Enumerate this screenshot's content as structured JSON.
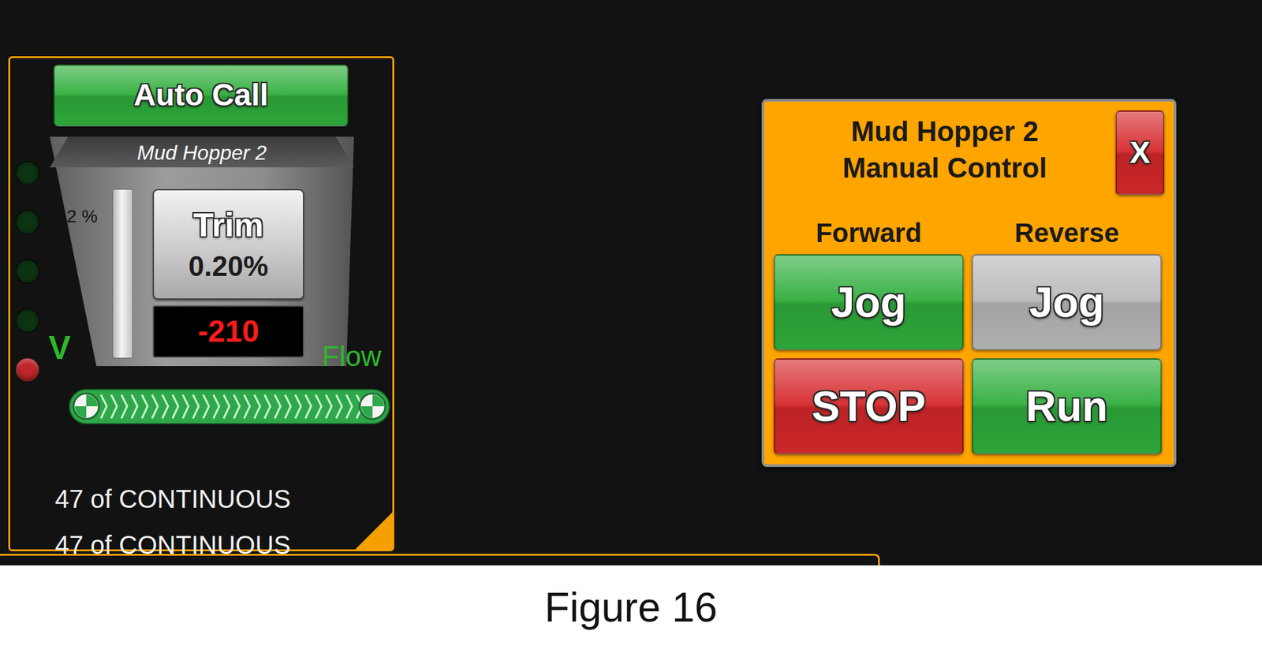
{
  "hopper_panel": {
    "auto_call": {
      "label": "Auto Call",
      "color": "#2fae3c"
    },
    "title": "Mud Hopper 2",
    "indicators": [
      {
        "on": false,
        "color": "#0d3a12"
      },
      {
        "on": false,
        "color": "#0d3a12"
      },
      {
        "on": false,
        "color": "#0d3a12"
      },
      {
        "on": false,
        "color": "#0d3a12"
      },
      {
        "on": true,
        "color": "#c0262b"
      }
    ],
    "level_reading": "-2 %",
    "level": 0,
    "trim": {
      "label": "Trim",
      "value": "0.20%"
    },
    "counter": "-210",
    "v_label": "V",
    "flow_label": "Flow",
    "conveyor_running": true,
    "status_lines": [
      "47 of CONTINUOUS",
      "47 of CONTINUOUS"
    ]
  },
  "manual_control": {
    "title_lines": [
      "Mud Hopper 2",
      "Manual Control"
    ],
    "close": "X",
    "column_labels": [
      "Forward",
      "Reverse"
    ],
    "buttons": [
      {
        "label": "Jog",
        "color": "#2fae3c"
      },
      {
        "label": "Jog",
        "color": "#b9b9b9"
      },
      {
        "label": "STOP",
        "color": "#d6282b"
      },
      {
        "label": "Run",
        "color": "#2fae3c"
      }
    ]
  },
  "caption": "Figure 16"
}
